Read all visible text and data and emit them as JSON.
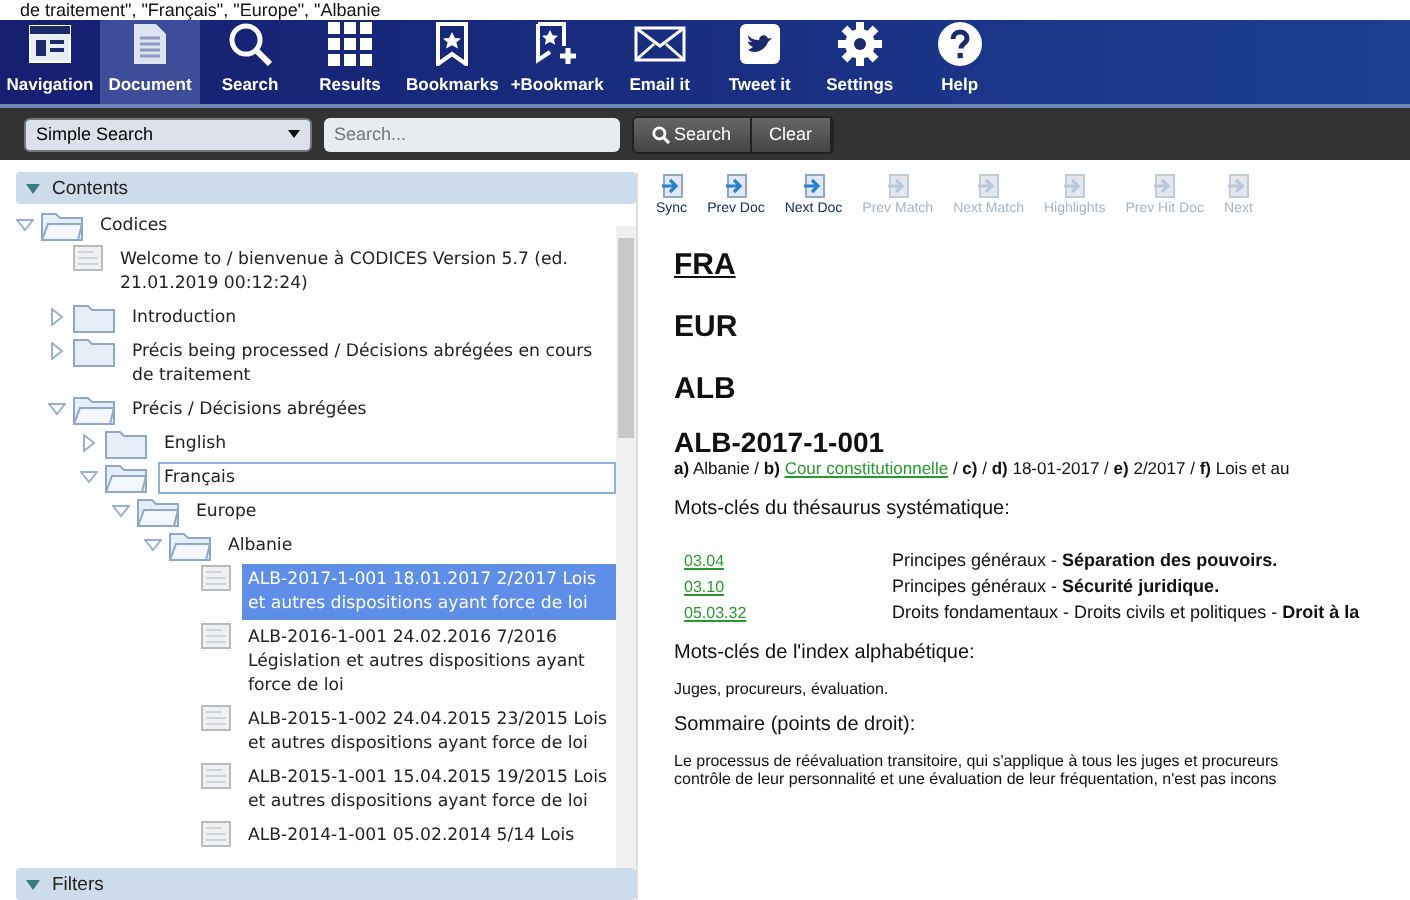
{
  "breadcrumb": "de traitement\", \"Français\", \"Europe\", \"Albanie",
  "toolbar": [
    {
      "label": "Navigation",
      "selected": false
    },
    {
      "label": "Document",
      "selected": true
    },
    {
      "label": "Search",
      "selected": false
    },
    {
      "label": "Results",
      "selected": false
    },
    {
      "label": "Bookmarks",
      "selected": false
    },
    {
      "label": "+Bookmark",
      "selected": false
    },
    {
      "label": "Email it",
      "selected": false
    },
    {
      "label": "Tweet it",
      "selected": false
    },
    {
      "label": "Settings",
      "selected": false
    },
    {
      "label": "Help",
      "selected": false
    }
  ],
  "search_bar": {
    "mode": "Simple Search",
    "placeholder": "Search...",
    "buttons": [
      "Search",
      "Clear"
    ]
  },
  "contents": {
    "title": "Contents",
    "tree": [
      {
        "label": "Codices",
        "kind": "folder",
        "expanded": true,
        "selected": false,
        "editing": false,
        "children": [
          {
            "label": "Welcome to / bienvenue à CODICES Version 5.7 (ed. 21.01.2019 00:12:24)",
            "kind": "doc",
            "selected": false,
            "editing": false
          },
          {
            "label": "Introduction",
            "kind": "folder",
            "expanded": false,
            "selected": false,
            "editing": false
          },
          {
            "label": "Précis being processed / Décisions abrégées en cours de traitement",
            "kind": "folder",
            "expanded": false,
            "selected": false,
            "editing": false
          },
          {
            "label": "Précis / Décisions abrégées",
            "kind": "folder",
            "expanded": true,
            "selected": false,
            "editing": false,
            "children": [
              {
                "label": "English",
                "kind": "folder",
                "expanded": false,
                "selected": false,
                "editing": false
              },
              {
                "label": "Français",
                "kind": "folder",
                "expanded": true,
                "selected": false,
                "editing": true,
                "children": [
                  {
                    "label": "Europe",
                    "kind": "folder",
                    "expanded": true,
                    "selected": false,
                    "editing": false,
                    "children": [
                      {
                        "label": "Albanie",
                        "kind": "folder",
                        "expanded": true,
                        "selected": false,
                        "editing": false,
                        "children": [
                          {
                            "label": "ALB-2017-1-001 18.01.2017 2/2017 Lois et autres dispositions ayant force de loi",
                            "kind": "doc",
                            "selected": true,
                            "editing": false
                          },
                          {
                            "label": "ALB-2016-1-001 24.02.2016 7/2016 Législation et autres dispositions ayant force de loi",
                            "kind": "doc",
                            "selected": false,
                            "editing": false
                          },
                          {
                            "label": "ALB-2015-1-002 24.04.2015 23/2015 Lois et autres dispositions ayant force de loi",
                            "kind": "doc",
                            "selected": false,
                            "editing": false
                          },
                          {
                            "label": "ALB-2015-1-001 15.04.2015 19/2015 Lois et autres dispositions ayant force de loi",
                            "kind": "doc",
                            "selected": false,
                            "editing": false
                          },
                          {
                            "label": "ALB-2014-1-001 05.02.2014 5/14 Lois",
                            "kind": "doc",
                            "selected": false,
                            "editing": false
                          }
                        ]
                      }
                    ]
                  }
                ]
              }
            ]
          }
        ]
      }
    ]
  },
  "filters": {
    "title": "Filters"
  },
  "doc_toolbar": [
    {
      "label": "Sync",
      "disabled": false
    },
    {
      "label": "Prev Doc",
      "disabled": false
    },
    {
      "label": "Next Doc",
      "disabled": false
    },
    {
      "label": "Prev Match",
      "disabled": true
    },
    {
      "label": "Next Match",
      "disabled": true
    },
    {
      "label": "Highlights",
      "disabled": true
    },
    {
      "label": "Prev Hit Doc",
      "disabled": true
    },
    {
      "label": "Next",
      "disabled": true
    }
  ],
  "document": {
    "headings": [
      {
        "text": "FRA",
        "underlined": true
      },
      {
        "text": "EUR",
        "underlined": false
      },
      {
        "text": "ALB",
        "underlined": false
      }
    ],
    "case_id": "ALB-2017-1-001",
    "meta": {
      "before": "**a)** Albanie / **b)**",
      "link": "Cour constitutionnelle",
      "after": "/ **c)** / **d)** 18-01-2017 / **e)** 2/2017 / **f)** Lois et au"
    },
    "thesaurus_title": "Mots-clés du thésaurus systématique:",
    "thesaurus": [
      {
        "code": "03.04",
        "text": "Principes généraux - **Séparation des pouvoirs.**"
      },
      {
        "code": "03.10",
        "text": "Principes généraux - **Sécurité juridique.**"
      },
      {
        "code": "05.03.32",
        "text": "Droits fondamentaux - Droits civils et politiques - **Droit à la**"
      }
    ],
    "index_title": "Mots-clés de l'index alphabétique:",
    "index_text": "Juges, procureurs, évaluation.",
    "summary_title": "Sommaire (points de droit):",
    "summary_lines": [
      "Le processus de réévaluation transitoire, qui s'applique à tous les juges et procureurs",
      "contrôle de leur personnalité et une évaluation de leur fréquentation, n'est pas incons"
    ]
  }
}
